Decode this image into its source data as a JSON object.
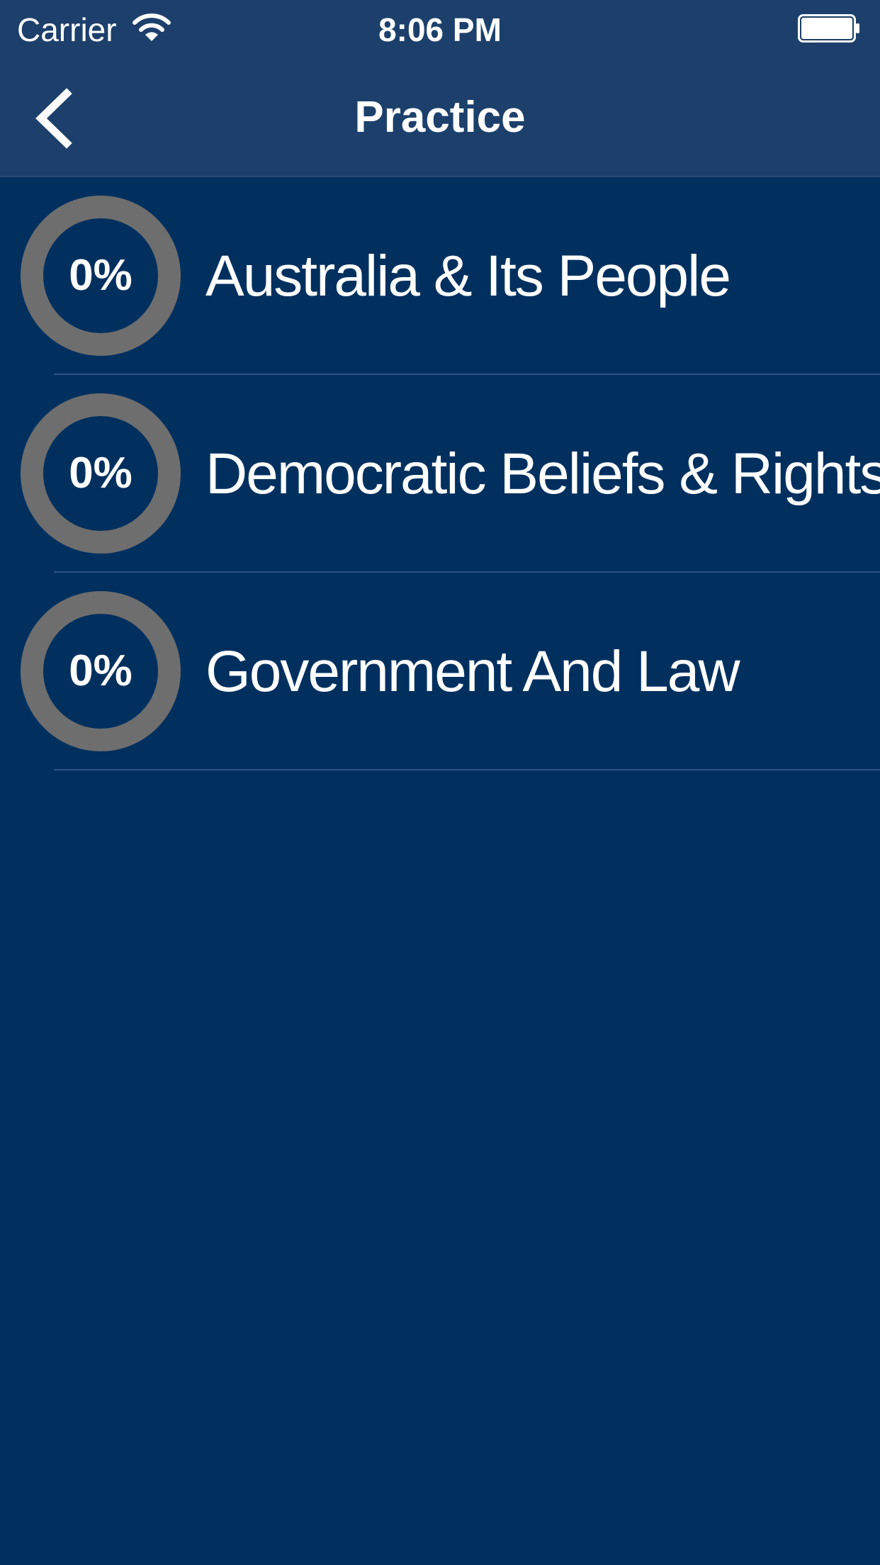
{
  "status_bar": {
    "carrier": "Carrier",
    "time": "8:06 PM",
    "wifi_icon": "wifi-icon",
    "battery_icon": "battery-icon"
  },
  "nav_bar": {
    "title": "Practice",
    "back_icon": "chevron-left-icon"
  },
  "colors": {
    "background": "#01305f",
    "nav_background": "#1c406b",
    "ring": "#6e6e6e",
    "divider": "#2f5380",
    "text": "#ffffff"
  },
  "topics": [
    {
      "title": "Australia & Its People",
      "progress_label": "0%",
      "progress": 0
    },
    {
      "title": "Democratic Beliefs & Rights",
      "progress_label": "0%",
      "progress": 0
    },
    {
      "title": "Government And Law",
      "progress_label": "0%",
      "progress": 0
    }
  ]
}
